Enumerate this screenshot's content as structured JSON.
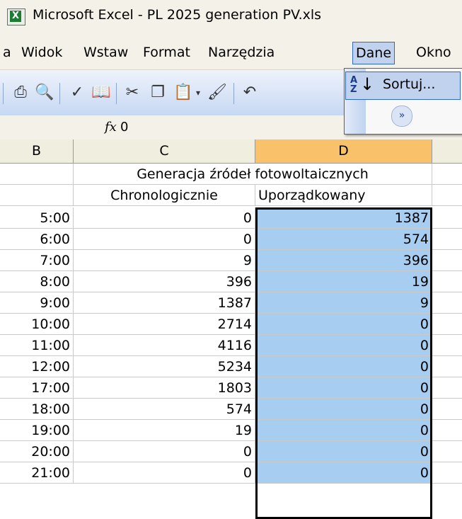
{
  "window": {
    "title": "Microsoft Excel - PL 2025 generation PV.xls"
  },
  "menu": {
    "items": [
      {
        "label": "a"
      },
      {
        "label": "Widok"
      },
      {
        "label": "Wstaw"
      },
      {
        "label": "Format"
      },
      {
        "label": "Narzędzia"
      },
      {
        "label": "Dane"
      },
      {
        "label": "Okno"
      }
    ]
  },
  "dropdown": {
    "sort_label": "Sortuj..."
  },
  "formula": {
    "value": "0"
  },
  "columns": [
    "B",
    "C",
    "D"
  ],
  "header_rows": {
    "group_title": "Generacja źródeł fotowoltaicznych",
    "col_c": "Chronologicznie",
    "col_d": "Uporządkowany"
  },
  "rows": [
    {
      "time": "5:00",
      "chrono": "0",
      "sorted": "1387"
    },
    {
      "time": "6:00",
      "chrono": "0",
      "sorted": "574"
    },
    {
      "time": "7:00",
      "chrono": "9",
      "sorted": "396"
    },
    {
      "time": "8:00",
      "chrono": "396",
      "sorted": "19"
    },
    {
      "time": "9:00",
      "chrono": "1387",
      "sorted": "9"
    },
    {
      "time": "10:00",
      "chrono": "2714",
      "sorted": "0"
    },
    {
      "time": "11:00",
      "chrono": "4116",
      "sorted": "0"
    },
    {
      "time": "12:00",
      "chrono": "5234",
      "sorted": "0"
    },
    {
      "time": "17:00",
      "chrono": "1803",
      "sorted": "0"
    },
    {
      "time": "18:00",
      "chrono": "574",
      "sorted": "0"
    },
    {
      "time": "19:00",
      "chrono": "19",
      "sorted": "0"
    },
    {
      "time": "20:00",
      "chrono": "0",
      "sorted": "0"
    },
    {
      "time": "21:00",
      "chrono": "0",
      "sorted": "0"
    }
  ],
  "icons": [
    "excel-icon",
    "print-icon",
    "print-preview-icon",
    "spelling-icon",
    "research-icon",
    "cut-icon",
    "copy-icon",
    "paste-icon",
    "format-painter-icon",
    "undo-icon",
    "sort-ascending-icon",
    "expand-menu-icon"
  ],
  "colors": {
    "selection": "#a7cdf0",
    "active_header": "#f9c16a"
  }
}
